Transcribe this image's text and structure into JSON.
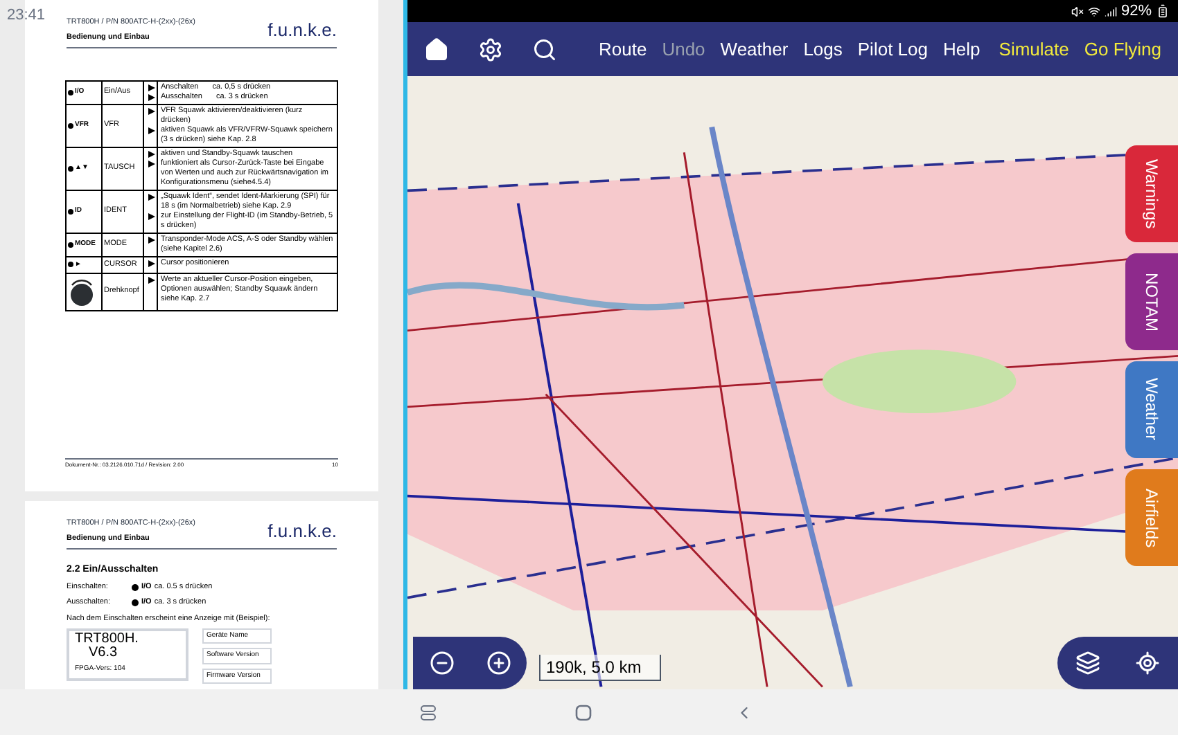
{
  "status_bar": {
    "time": "23:41",
    "battery": "92%"
  },
  "document": {
    "pages": [
      {
        "header": {
          "title": "TRT800H / P/N 800ATC-H-(2xx)-(26x)",
          "subtitle": "Bedienung und Einbau",
          "logo": "f.u.n.k.e."
        },
        "table": {
          "rows": [
            {
              "kind": "button",
              "key": "I/O",
              "function": "Ein/Aus",
              "items": [
                {
                  "text": "Anschalten",
                  "note": "ca. 0,5 s drücken"
                },
                {
                  "text": "Ausschalten",
                  "note": "ca. 3 s drücken"
                }
              ]
            },
            {
              "kind": "button",
              "key": "VFR",
              "function": "VFR",
              "items": [
                {
                  "text": "VFR Squawk aktivieren/deaktivieren (kurz drücken)"
                },
                {
                  "text": "aktiven Squawk als VFR/VFRW-Squawk speichern (3 s drücken) siehe Kap. 2.8"
                }
              ]
            },
            {
              "kind": "button",
              "key": "▲▼",
              "function": "TAUSCH",
              "items": [
                {
                  "text": "aktiven und Standby-Squawk tauschen"
                },
                {
                  "text": "funktioniert als Cursor-Zurück-Taste bei Eingabe von Werten und auch zur Rückwärtsnavigation im Konfigurationsmenu (siehe4.5.4)"
                }
              ]
            },
            {
              "kind": "button",
              "key": "ID",
              "function": "IDENT",
              "items": [
                {
                  "text": "„Squawk Ident“, sendet Ident-Markierung (SPI) für 18 s (im Normalbetrieb) siehe Kap. 2.9"
                },
                {
                  "text": "zur Einstellung der Flight-ID (im Standby-Betrieb, 5 s drücken)"
                }
              ]
            },
            {
              "kind": "button",
              "key": "MODE",
              "function": "MODE",
              "items": [
                {
                  "text": "Transponder-Mode ACS, A-S oder Standby wählen (siehe Kapitel 2.6)"
                }
              ]
            },
            {
              "kind": "button",
              "key": "►",
              "function": "CURSOR",
              "items": [
                {
                  "text": "Cursor positionieren"
                }
              ]
            },
            {
              "kind": "knob",
              "function": "Drehknopf",
              "items": [
                {
                  "text": "Werte an aktueller Cursor-Position eingeben, Optionen auswählen; Standby Squawk ändern siehe Kap. 2.7"
                }
              ]
            }
          ]
        },
        "footer": {
          "document_number": "Dokument-Nr.: 03.2126.010.71d / Revision: 2.00",
          "page": "10"
        }
      },
      {
        "header": {
          "title": "TRT800H / P/N 800ATC-H-(2xx)-(26x)",
          "subtitle": "Bedienung und Einbau",
          "logo": "f.u.n.k.e."
        },
        "section": "2.2 Ein/Ausschalten",
        "lines": [
          {
            "label": "Einschalten:",
            "key": "I/O",
            "action": "ca. 0.5 s drücken"
          },
          {
            "label": "Ausschalten:",
            "key": "I/O",
            "action": "ca. 3 s drücken"
          }
        ],
        "paragraph": "Nach dem Einschalten erscheint eine Anzeige mit (Beispiel):",
        "display": {
          "lines": [
            "TRT800H.",
            "V6.3",
            "FPGA-Vers: 104"
          ],
          "callouts": [
            "Geräte Name",
            "Software Version",
            "Firmware Version"
          ]
        }
      }
    ]
  },
  "map_app": {
    "toolbar": {
      "menu": [
        {
          "label": "Route",
          "kind": "nav",
          "disabled": false
        },
        {
          "label": "Undo",
          "kind": "nav",
          "disabled": true
        },
        {
          "label": "Weather",
          "kind": "nav",
          "disabled": false
        },
        {
          "label": "Logs",
          "kind": "nav",
          "disabled": false
        },
        {
          "label": "Pilot Log",
          "kind": "nav",
          "disabled": false
        },
        {
          "label": "Help",
          "kind": "nav",
          "disabled": false
        },
        {
          "label": "Simulate",
          "kind": "action",
          "disabled": false
        },
        {
          "label": "Go Flying",
          "kind": "action",
          "disabled": false
        }
      ]
    },
    "side_tabs": [
      {
        "label": "Warnings",
        "color": "#d9283a"
      },
      {
        "label": "NOTAM",
        "color": "#8e2a8c"
      },
      {
        "label": "Weather",
        "color": "#3f78c4"
      },
      {
        "label": "Airfields",
        "color": "#e07b1c"
      }
    ],
    "scale": "190k, 5.0 km"
  }
}
